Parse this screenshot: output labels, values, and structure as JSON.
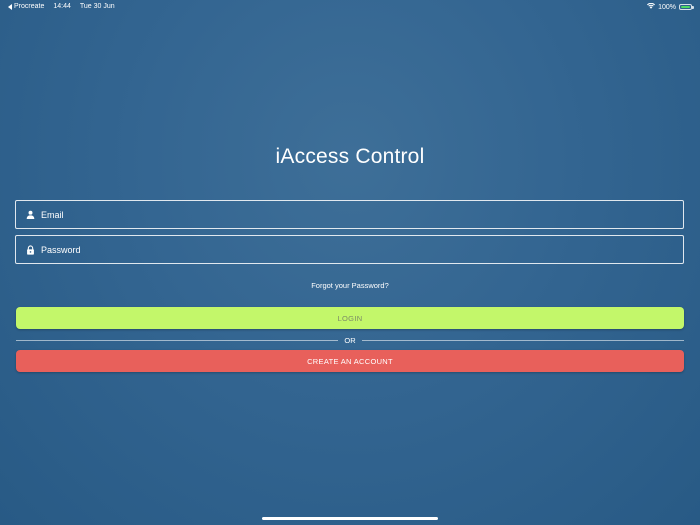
{
  "status_bar": {
    "back_app": "Procreate",
    "time": "14:44",
    "date": "Tue 30 Jun",
    "battery_percent": "100%",
    "battery_level": 1.0
  },
  "app": {
    "title": "iAccess Control"
  },
  "form": {
    "email_placeholder": "Email",
    "email_value": "",
    "password_placeholder": "Password",
    "password_value": "",
    "forgot_label": "Forgot your Password?"
  },
  "actions": {
    "login_label": "LOGIN",
    "or_label": "OR",
    "create_label": "CREATE AN ACCOUNT"
  },
  "icons": {
    "email": "user-icon",
    "password": "lock-icon",
    "wifi": "wifi-icon",
    "battery": "battery-icon"
  },
  "colors": {
    "login": "#c3f76a",
    "create": "#e8605b",
    "battery_fill": "#4cd964"
  }
}
